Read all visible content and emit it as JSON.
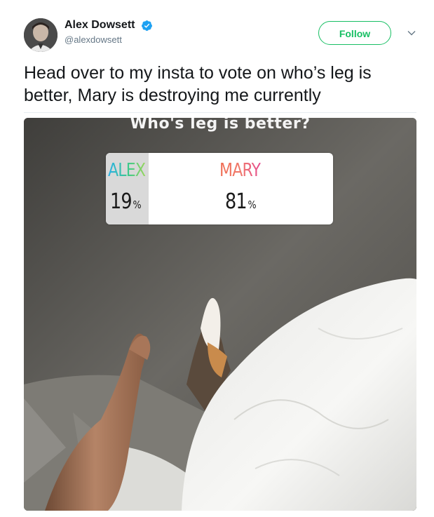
{
  "tweet": {
    "author": {
      "display_name": "Alex Dowsett",
      "handle": "@alexdowsett",
      "verified": true
    },
    "follow_label": "Follow",
    "text": "Head over to my insta to vote on who’s leg is better, Mary is destroying me currently"
  },
  "media": {
    "story_title": "Who's leg is better?",
    "poll": {
      "options": [
        {
          "label": "ALEX",
          "percent": "19",
          "unit": "%"
        },
        {
          "label": "MARY",
          "percent": "81",
          "unit": "%"
        }
      ]
    }
  },
  "colors": {
    "follow_green": "#17bf63",
    "verified_blue": "#1da1f2",
    "text_dark": "#14171a",
    "text_muted": "#657786"
  },
  "icons": {
    "verified": "verified-badge-icon",
    "caret": "chevron-down-icon"
  }
}
